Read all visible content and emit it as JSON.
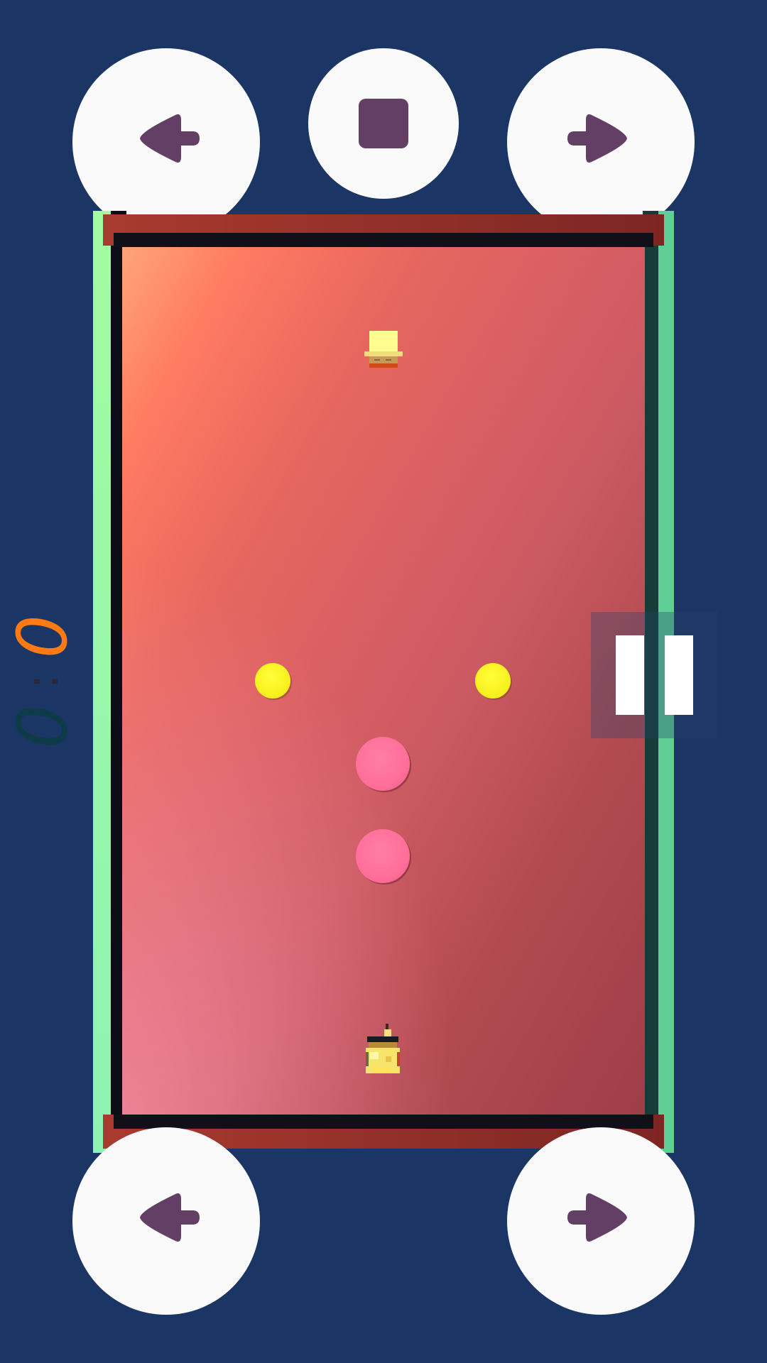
{
  "colors": {
    "background": "#1b3565",
    "button_bg": "#fafafa",
    "icon": "#633f66",
    "rail_green": "#8ef3b2",
    "wall": "#a93a2f",
    "coin": "#f7ef1b",
    "ball": "#ff6e98",
    "score_player1": "#ff7a12",
    "score_player2": "#0e3b48"
  },
  "controls": {
    "top_left": {
      "icon": "arrow-left-icon"
    },
    "top_stop": {
      "icon": "stop-square-icon"
    },
    "top_right": {
      "icon": "arrow-right-icon"
    },
    "bottom_left": {
      "icon": "arrow-left-icon"
    },
    "bottom_right": {
      "icon": "arrow-right-icon"
    },
    "pause": {
      "icon": "pause-icon"
    }
  },
  "score": {
    "player1": "0",
    "separator": ":",
    "player2": "0"
  },
  "objects": {
    "coins": 2,
    "balls": 2,
    "characters": [
      "top-cart-character",
      "bottom-cart-character"
    ]
  }
}
